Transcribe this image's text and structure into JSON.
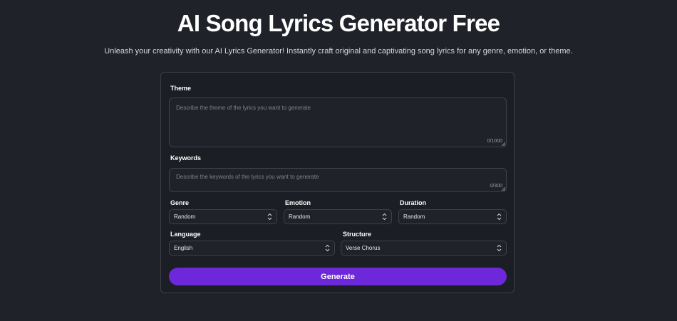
{
  "header": {
    "title": "AI Song Lyrics Generator Free",
    "subtitle": "Unleash your creativity with our AI Lyrics Generator! Instantly craft original and captivating song lyrics for any genre, emotion, or theme."
  },
  "form": {
    "theme": {
      "label": "Theme",
      "value": "",
      "placeholder": "Describe the theme of the lyrics you want to generate",
      "counter": "0/1000"
    },
    "keywords": {
      "label": "Keywords",
      "value": "",
      "placeholder": "Describe the keywords of the lyrics you want to generate",
      "counter": "0/300"
    },
    "genre": {
      "label": "Genre",
      "value": "Random"
    },
    "emotion": {
      "label": "Emotion",
      "value": "Random"
    },
    "duration": {
      "label": "Duration",
      "value": "Random"
    },
    "language": {
      "label": "Language",
      "value": "English"
    },
    "structure": {
      "label": "Structure",
      "value": "Verse Chorus"
    },
    "generate_label": "Generate"
  },
  "icons": {
    "select_chevron": "chevron-up-down-icon",
    "resize_grip": "resize-grip-icon"
  },
  "colors": {
    "background": "#1f2229",
    "card": "#1b1e25",
    "accent": "#6d28d9"
  }
}
